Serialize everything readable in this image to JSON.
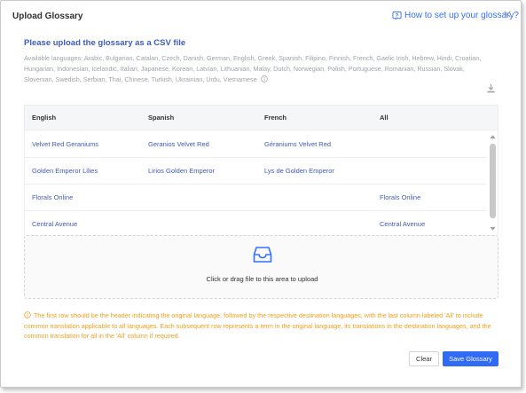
{
  "dialog": {
    "title": "Upload Glossary",
    "help_link": "How to set up your glossary?"
  },
  "intro": {
    "heading": "Please upload the glossary as a CSV file",
    "languages": "Available languages: Arabic, Bulgarian, Catalan, Czech, Danish, German, English, Greek, Spanish, Filipino, Finnish, French, Gaelic Irish, Hebrew, Hindi, Croatian, Hungarian, Indonesian, Icelandic, Italian, Japanese, Korean, Latvian, Lithuanian, Malay, Dutch, Norwegian, Polish, Portuguese, Romanian, Russian, Slovak, Slovenian, Swedish, Serbian, Thai, Chinese, Turkish, Ukrainian, Urdu, Vietnamese"
  },
  "table": {
    "headers": [
      "English",
      "Spanish",
      "French",
      "All"
    ],
    "rows": [
      [
        "Velvet Red Geraniums",
        "Geranios Velvet Red",
        "Géraniums Velvet Red",
        ""
      ],
      [
        "Golden Emperor Lilies",
        "Lirios Golden Emperor",
        "Lys de Golden Emperor",
        ""
      ],
      [
        "Florals Online",
        "",
        "",
        "Florals Online"
      ],
      [
        "Central Avenue",
        "",
        "",
        "Central Avenue"
      ]
    ]
  },
  "dropzone": {
    "text": "Click or drag file to this area to upload"
  },
  "note": "The first row should be the header indicating the original language, followed by the respective destination languages, with the last column labeled 'All' to include common translation applicable to all languages. Each subsequent row represents a term in the original language, its translations in the destination languages, and the common translation for all in the 'All' column if required.",
  "buttons": {
    "clear": "Clear",
    "save": "Save Glossary"
  },
  "colors": {
    "accent": "#2f6bf5",
    "link": "#3370ff",
    "heading": "#3d5bc0",
    "warning": "#f0a020"
  },
  "icons": {
    "help": "help-circle-icon",
    "close": "close-icon",
    "info": "info-icon",
    "download": "download-icon",
    "upload": "inbox-upload-icon",
    "warning": "warning-circle-icon"
  }
}
